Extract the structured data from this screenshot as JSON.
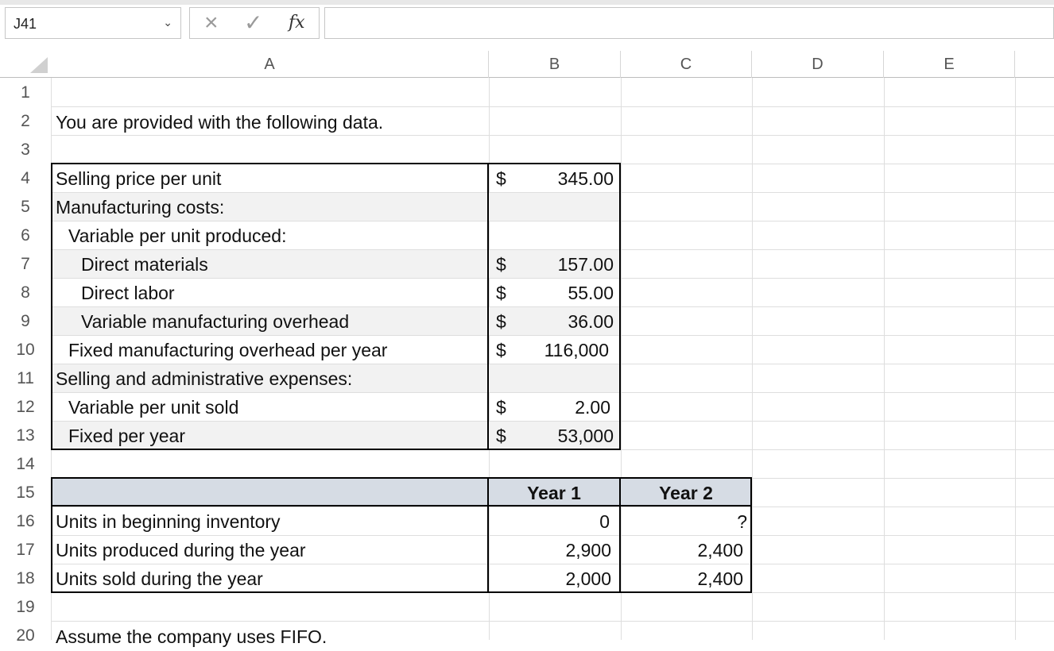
{
  "formula_bar": {
    "name_box": "J41",
    "cancel_icon": "×",
    "enter_icon": "✓",
    "fx_label": "fx",
    "formula": ""
  },
  "columns": [
    "A",
    "B",
    "C",
    "D",
    "E"
  ],
  "rows": [
    "1",
    "2",
    "3",
    "4",
    "5",
    "6",
    "7",
    "8",
    "9",
    "10",
    "11",
    "12",
    "13",
    "14",
    "15",
    "16",
    "17",
    "18",
    "19",
    "20"
  ],
  "sheet": {
    "intro": "You are provided with the following data.",
    "cost_table": [
      {
        "label": "Selling price per unit",
        "indent": 0,
        "dollar": "$",
        "value": "345.00"
      },
      {
        "label": "Manufacturing costs:",
        "indent": 0,
        "dollar": "",
        "value": ""
      },
      {
        "label": "Variable per unit produced:",
        "indent": 1,
        "dollar": "",
        "value": ""
      },
      {
        "label": "Direct materials",
        "indent": 2,
        "dollar": "$",
        "value": "157.00"
      },
      {
        "label": "Direct labor",
        "indent": 2,
        "dollar": "$",
        "value": "55.00"
      },
      {
        "label": "Variable manufacturing overhead",
        "indent": 2,
        "dollar": "$",
        "value": "36.00"
      },
      {
        "label": "Fixed manufacturing overhead per year",
        "indent": 1,
        "dollar": "$",
        "value": "116,000"
      },
      {
        "label": "Selling and administrative expenses:",
        "indent": 0,
        "dollar": "",
        "value": ""
      },
      {
        "label": "Variable per unit sold",
        "indent": 1,
        "dollar": "$",
        "value": "2.00"
      },
      {
        "label": "Fixed per year",
        "indent": 1,
        "dollar": "$",
        "value": "53,000"
      }
    ],
    "units_table": {
      "headers": [
        "Year 1",
        "Year 2"
      ],
      "rows": [
        {
          "label": "Units in beginning inventory",
          "year1": "0",
          "year2": "?"
        },
        {
          "label": "Units produced during the year",
          "year1": "2,900",
          "year2": "2,400"
        },
        {
          "label": "Units sold during the year",
          "year1": "2,000",
          "year2": "2,400"
        }
      ]
    },
    "footnote": "Assume the company uses FIFO."
  }
}
